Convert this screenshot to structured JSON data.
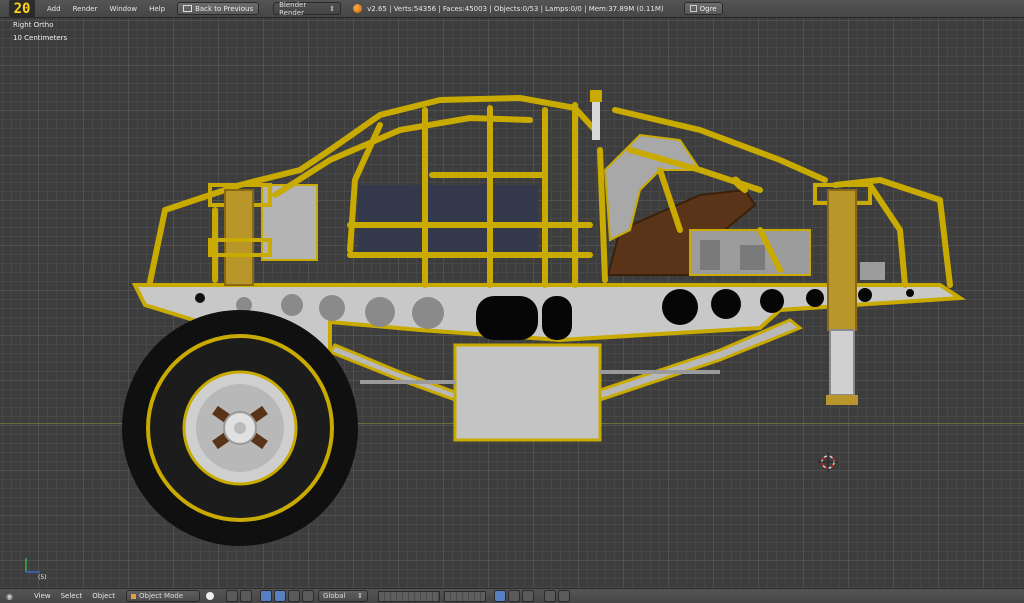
{
  "header": {
    "frame_number": "20",
    "menu": [
      "Add",
      "Render",
      "Window",
      "Help"
    ],
    "back_button": "Back to Previous",
    "render_engine": "Blender Render",
    "stats": "v2.65 | Verts:54356 | Faces:45003 | Objects:0/53 | Lamps:0/0 | Mem:37.89M (0.11M)",
    "ogre_button": "Ogre"
  },
  "viewport": {
    "view_name": "Right Ortho",
    "grid_scale": "10 Centimeters",
    "frame_indicator": "(5)"
  },
  "footer": {
    "menu": [
      "View",
      "Select",
      "Object"
    ],
    "mode": "Object Mode",
    "orientation": "Global"
  },
  "colors": {
    "frame_yellow": "#c8aa00",
    "body_grey": "#c8c8c8",
    "tire_black": "#121212",
    "seat_brown": "#5a3418",
    "accent_blue": "#5680c2"
  }
}
